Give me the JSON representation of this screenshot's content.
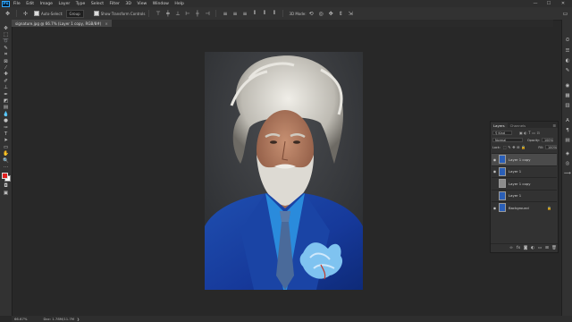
{
  "app": {
    "logo": "Ps"
  },
  "menu": [
    "File",
    "Edit",
    "Image",
    "Layer",
    "Type",
    "Select",
    "Filter",
    "3D",
    "View",
    "Window",
    "Help"
  ],
  "window_controls": {
    "minimize": "—",
    "maximize": "☐",
    "close": "✕"
  },
  "options_bar": {
    "move_icon": "move-tool-icon",
    "auto_select_label": "Auto-Select:",
    "auto_select_value": "Group",
    "show_transform_label": "Show Transform Controls",
    "mode_3d_label": "3D Mode:"
  },
  "document": {
    "tab_title": "signature.jpg @ 66.7% (Layer 1 copy, RGB/8#)",
    "close": "×"
  },
  "layers_panel": {
    "tabs": [
      "Layers",
      "Channels"
    ],
    "filter_label": "Kind",
    "blend_mode": "Normal",
    "opacity_label": "Opacity:",
    "opacity_value": "100%",
    "lock_label": "Lock:",
    "fill_label": "Fill:",
    "fill_value": "100%",
    "layers": [
      {
        "name": "Layer 1 copy",
        "visible": true,
        "selected": true,
        "thumb": "#2a5fb8"
      },
      {
        "name": "Layer 1",
        "visible": true,
        "selected": false,
        "thumb": "#2a5fb8"
      },
      {
        "name": "Layer 1 copy",
        "visible": false,
        "selected": false,
        "thumb": "#8c8c8c"
      },
      {
        "name": "Layer 1",
        "visible": false,
        "selected": false,
        "thumb": "#2a5fb8"
      },
      {
        "name": "Background",
        "visible": true,
        "selected": false,
        "thumb": "#2a5fb8",
        "locked": true
      }
    ]
  },
  "status_bar": {
    "zoom": "66.67%",
    "doc_info": "Doc: 1.78M/11.7M"
  },
  "colors": {
    "foreground": "#e02020",
    "background": "#ffffff",
    "canvas_bg": "#282828",
    "panel_bg": "#323232",
    "accent": "#31a8ff"
  }
}
